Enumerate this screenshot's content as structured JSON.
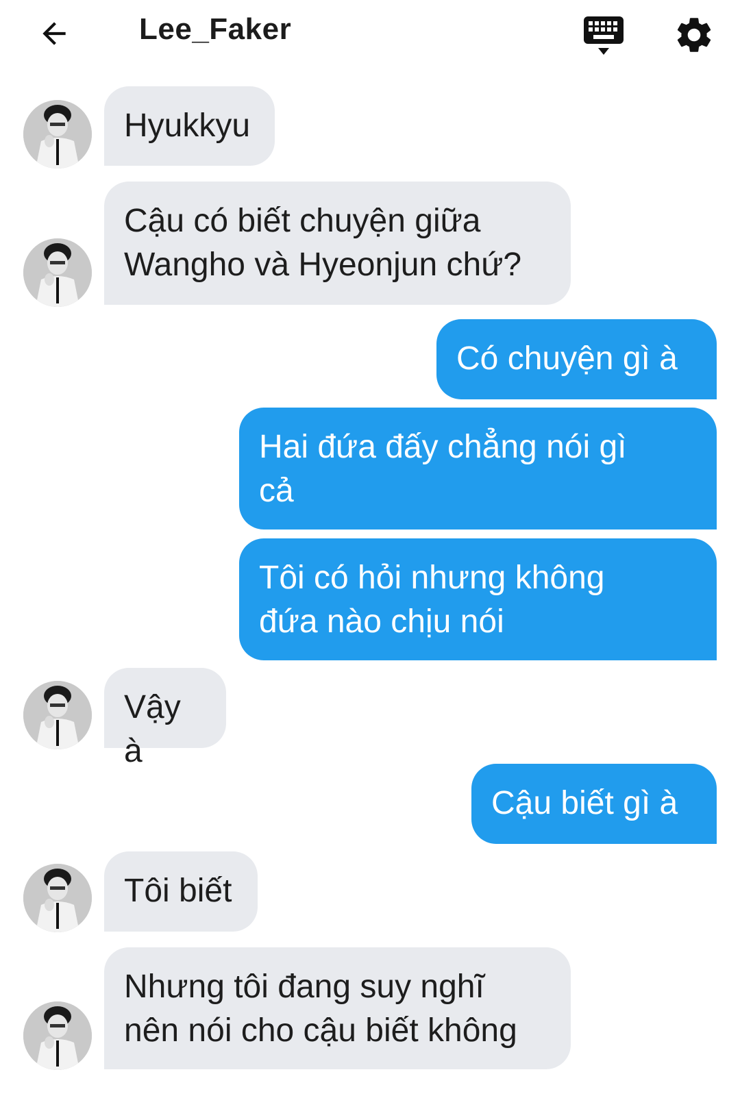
{
  "header": {
    "title": "Lee_Faker",
    "back_icon": "arrow-left-icon",
    "keyboard_icon": "keyboard-icon",
    "settings_icon": "gear-icon"
  },
  "colors": {
    "incoming_bubble": "#e8eaee",
    "outgoing_bubble": "#219ced",
    "text_dark": "#1d1d1d",
    "text_light": "#ffffff"
  },
  "messages": [
    {
      "sender": "other",
      "text": "Hyukkyu"
    },
    {
      "sender": "other",
      "text": "Cậu có biết chuyện giữa\nWangho và Hyeonjun chứ?"
    },
    {
      "sender": "me",
      "text": "Có chuyện gì à"
    },
    {
      "sender": "me",
      "text": "Hai đứa đấy chẳng nói gì\ncả"
    },
    {
      "sender": "me",
      "text": "Tôi có hỏi nhưng không\nđứa nào chịu nói"
    },
    {
      "sender": "other",
      "text": "Vậy à"
    },
    {
      "sender": "me",
      "text": "Cậu biết gì à"
    },
    {
      "sender": "other",
      "text": "Tôi biết"
    },
    {
      "sender": "other",
      "text": "Nhưng tôi đang suy nghĩ\nnên nói cho cậu biết không"
    }
  ]
}
